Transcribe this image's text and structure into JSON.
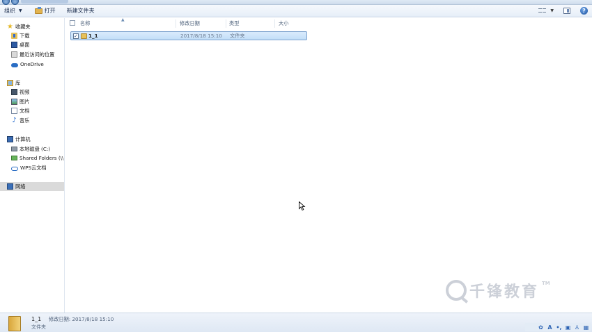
{
  "toolbar": {
    "organize_label": "组织",
    "open_label": "打开",
    "new_folder_label": "新建文件夹"
  },
  "nav": {
    "favorites": "收藏夹",
    "downloads": "下载",
    "desktop": "桌面",
    "recent": "最近访问的位置",
    "onedrive": "OneDrive",
    "libraries": "库",
    "videos": "视频",
    "pictures": "图片",
    "documents": "文档",
    "music": "音乐",
    "computer": "计算机",
    "local_disk": "本地磁盘 (C:)",
    "shared_folders": "Shared Folders (\\\\",
    "wps_cloud": "WPS云文档",
    "network": "网络"
  },
  "columns": {
    "name": "名称",
    "modified": "修改日期",
    "type": "类型",
    "size": "大小"
  },
  "files": [
    {
      "name": "1_1",
      "modified": "2017/8/18 15:10",
      "type": "文件夹",
      "size": "",
      "checked": true
    }
  ],
  "details": {
    "name": "1_1",
    "meta": "修改日期: 2017/8/18 15:10",
    "type": "文件夹"
  },
  "watermark": {
    "text": "千锋教育",
    "tm": "TM"
  }
}
